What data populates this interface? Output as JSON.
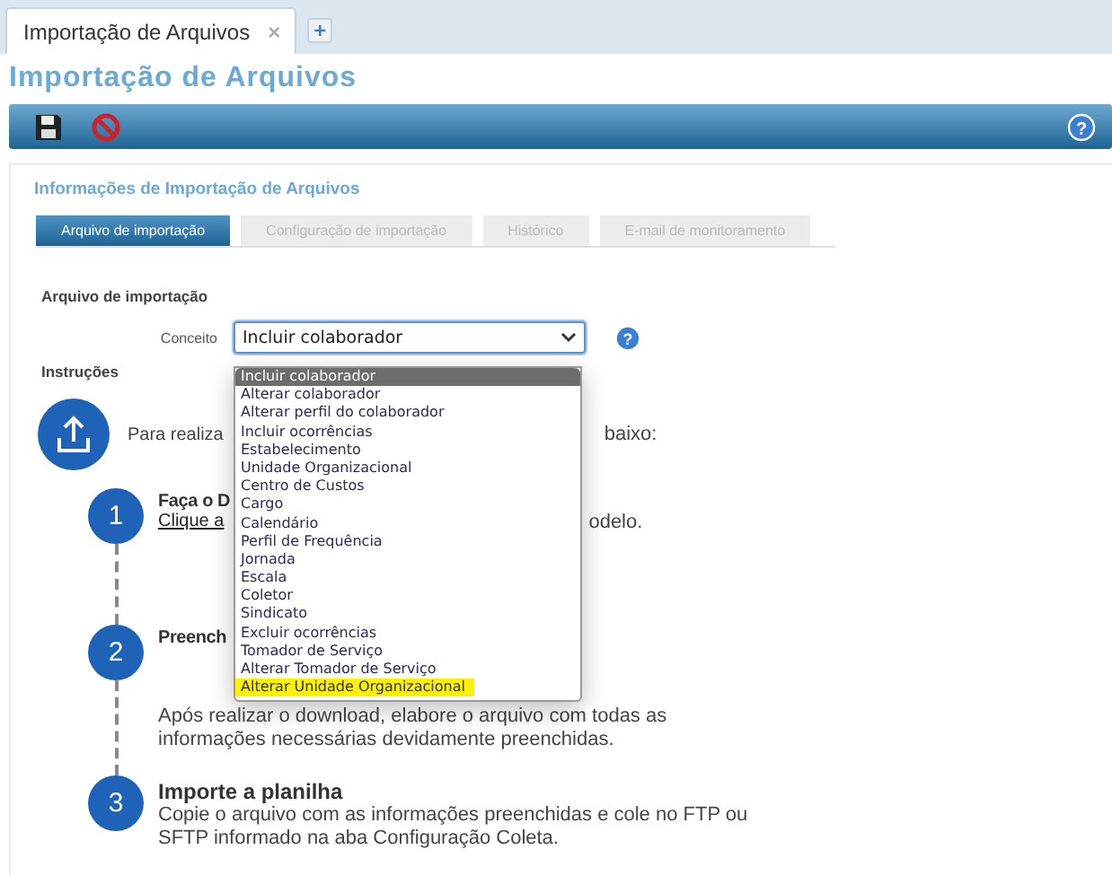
{
  "browser_tabs": [
    {
      "label": "Importação de Arquivos",
      "close": "×",
      "selected": true
    }
  ],
  "new_tab": "+",
  "page_title": "Importação de Arquivos",
  "toolbar": {
    "help": "?"
  },
  "panel": {
    "title": "Informações de Importação de Arquivos",
    "tabs": [
      {
        "label": "Arquivo de importação",
        "selected": true
      },
      {
        "label": "Configuração de importação",
        "selected": false
      },
      {
        "label": "Histórico",
        "selected": false
      },
      {
        "label": "E-mail de monitoramento",
        "selected": false
      }
    ],
    "section_title": "Arquivo de importação",
    "field": {
      "label": "Conceito",
      "value": "Incluir colaborador",
      "expanded": true,
      "help": "?"
    },
    "instructions_title": "Instruções",
    "intro": {
      "before": "Para realiza",
      "after": "baixo:"
    },
    "steps": [
      {
        "number": "1",
        "heading": "Faça o D",
        "link": "Clique a",
        "after": "odelo."
      },
      {
        "number": "2",
        "heading": "Preench",
        "lines": [
          "Após realizar o download, elabore o arquivo com todas as",
          "informações necessárias devidamente preenchidas."
        ]
      },
      {
        "number": "3",
        "heading": "Importe a planilha",
        "lines": [
          "Copie o arquivo com as informações preenchidas e cole no FTP ou",
          "SFTP informado na aba Configuração Coleta."
        ]
      }
    ],
    "options": [
      {
        "label": "Incluir colaborador",
        "selected": true,
        "highlighted": false
      },
      {
        "label": "Alterar colaborador",
        "selected": false,
        "highlighted": false
      },
      {
        "label": "Alterar perfil do colaborador",
        "selected": false,
        "highlighted": false
      },
      {
        "label": "Incluir ocorrências",
        "selected": false,
        "highlighted": false
      },
      {
        "label": "Estabelecimento",
        "selected": false,
        "highlighted": false
      },
      {
        "label": "Unidade Organizacional",
        "selected": false,
        "highlighted": false
      },
      {
        "label": "Centro de Custos",
        "selected": false,
        "highlighted": false
      },
      {
        "label": "Cargo",
        "selected": false,
        "highlighted": false
      },
      {
        "label": "Calendário",
        "selected": false,
        "highlighted": false
      },
      {
        "label": "Perfil de Frequência",
        "selected": false,
        "highlighted": false
      },
      {
        "label": "Jornada",
        "selected": false,
        "highlighted": false
      },
      {
        "label": "Escala",
        "selected": false,
        "highlighted": false
      },
      {
        "label": "Coletor",
        "selected": false,
        "highlighted": false
      },
      {
        "label": "Sindicato",
        "selected": false,
        "highlighted": false
      },
      {
        "label": "Excluir ocorrências",
        "selected": false,
        "highlighted": false
      },
      {
        "label": "Tomador de Serviço",
        "selected": false,
        "highlighted": false
      },
      {
        "label": "Alterar Tomador de Serviço",
        "selected": false,
        "highlighted": false
      },
      {
        "label": "Alterar Unidade Organizacional",
        "selected": false,
        "highlighted": true
      }
    ]
  }
}
